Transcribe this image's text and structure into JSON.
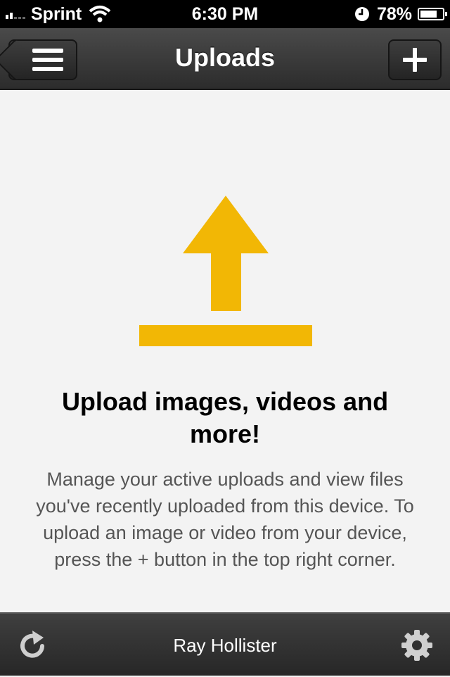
{
  "status_bar": {
    "carrier": "Sprint",
    "time": "6:30 PM",
    "battery_percent": "78%",
    "battery_level": 0.78,
    "icons": [
      "signal-icon",
      "wifi-icon",
      "clock-icon",
      "battery-icon"
    ]
  },
  "nav": {
    "title": "Uploads",
    "menu_icon": "hamburger-icon",
    "add_icon": "plus-icon"
  },
  "empty_state": {
    "icon": "upload-arrow-icon",
    "headline": "Upload images, videos and more!",
    "description": "Manage your active uploads and view files you've recently uploaded from this device. To upload an image or video from your device, press the + button in the top right corner."
  },
  "toolbar": {
    "user_name": "Ray Hollister",
    "refresh_icon": "refresh-icon",
    "settings_icon": "gear-icon"
  },
  "colors": {
    "accent": "#F2B705",
    "nav_bg": "#3a3a3a",
    "content_bg": "#f3f3f3"
  }
}
